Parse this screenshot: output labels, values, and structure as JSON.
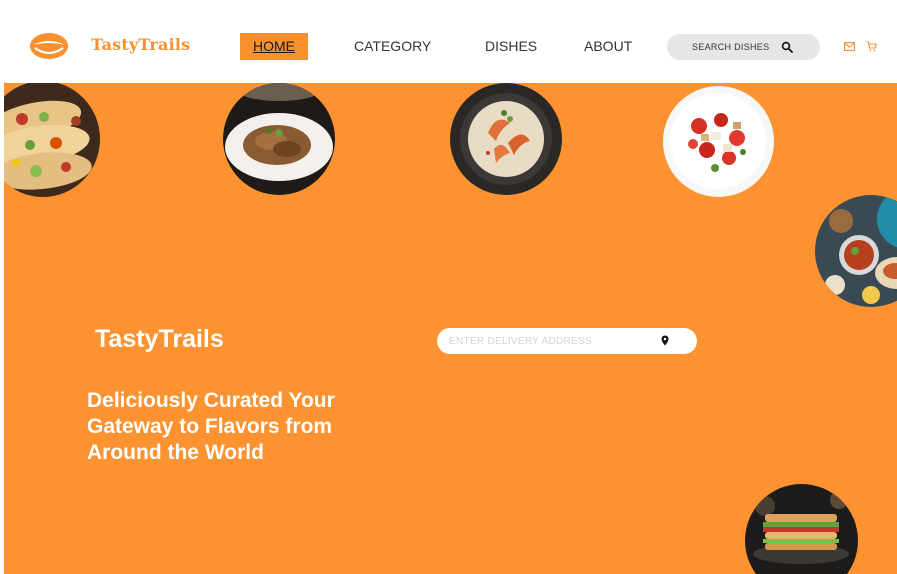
{
  "brand": {
    "name": "TastyTrails",
    "color": "#f7902f"
  },
  "nav": {
    "items": [
      {
        "label": "HOME",
        "active": true
      },
      {
        "label": "CATEGORY"
      },
      {
        "label": "DISHES"
      },
      {
        "label": "ABOUT"
      }
    ]
  },
  "search": {
    "placeholder": "SEARCH DISHES",
    "icon": "search-icon"
  },
  "header_icons": [
    "mail-icon",
    "cart-icon"
  ],
  "hero": {
    "background": "#fc9230",
    "title": "TastyTrails",
    "tagline": "Deliciously Curated Your Gateway to Flavors from Around the World",
    "address": {
      "placeholder": "ENTER DELIVERY ADDRESS",
      "value": "",
      "icon": "location-pin-icon"
    },
    "dishes": [
      "tacos-dish",
      "plated-meat-dish",
      "shrimp-soup-dish",
      "salad-dish",
      "platter-dish",
      "sandwich-dish"
    ]
  }
}
